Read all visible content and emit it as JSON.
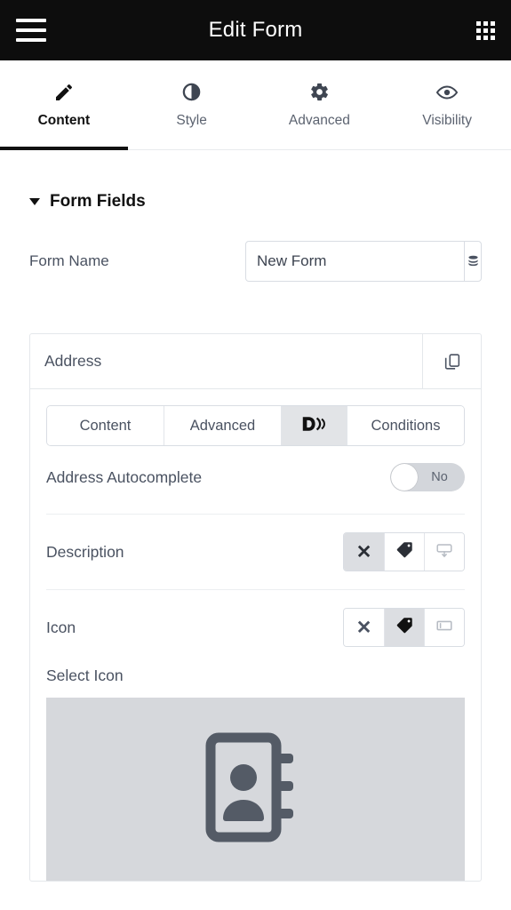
{
  "topbar": {
    "menu_icon": "hamburger-menu-icon",
    "title": "Edit Form",
    "apps_icon": "grid-apps-icon"
  },
  "main_tabs": [
    {
      "label": "Content",
      "icon": "pencil-icon",
      "active": true
    },
    {
      "label": "Style",
      "icon": "contrast-icon",
      "active": false
    },
    {
      "label": "Advanced",
      "icon": "gear-icon",
      "active": false
    },
    {
      "label": "Visibility",
      "icon": "eye-icon",
      "active": false
    }
  ],
  "section": {
    "title": "Form Fields",
    "collapsed": false
  },
  "form_name": {
    "label": "Form Name",
    "value": "New Form",
    "placeholder": "Form Name",
    "button_icon": "database-stack-icon"
  },
  "field_card": {
    "name": "Address",
    "duplicate_icon": "copy-duplicate-icon",
    "sub_tabs": [
      {
        "label": "Content",
        "selected": false,
        "icon": null
      },
      {
        "label": "Advanced",
        "selected": false,
        "icon": null
      },
      {
        "label": "D)",
        "selected": true,
        "icon": "dynamic-tag-logo-icon"
      },
      {
        "label": "Conditions",
        "selected": false,
        "icon": null
      }
    ],
    "autocomplete": {
      "label": "Address Autocomplete",
      "value": "No",
      "enabled": false
    },
    "description": {
      "label": "Description",
      "buttons": [
        {
          "icon": "close-x-icon",
          "selected": true
        },
        {
          "icon": "tag-icon",
          "selected": false
        },
        {
          "icon": "tooltip-icon",
          "selected": false
        }
      ]
    },
    "icon_setting": {
      "label": "Icon",
      "buttons": [
        {
          "icon": "close-x-icon",
          "selected": false
        },
        {
          "icon": "tag-icon",
          "selected": true
        },
        {
          "icon": "panel-left-icon",
          "selected": false
        }
      ],
      "select_label": "Select Icon",
      "preview_icon": "address-book-contact-icon"
    }
  },
  "colors": {
    "topbar_bg": "#0d0d0d",
    "accent_active": "#111111",
    "text_muted": "#4a5261",
    "segment_selected_bg": "#e2e4e7",
    "preview_bg": "#d6d8dc",
    "icon_fill": "#545b66"
  }
}
